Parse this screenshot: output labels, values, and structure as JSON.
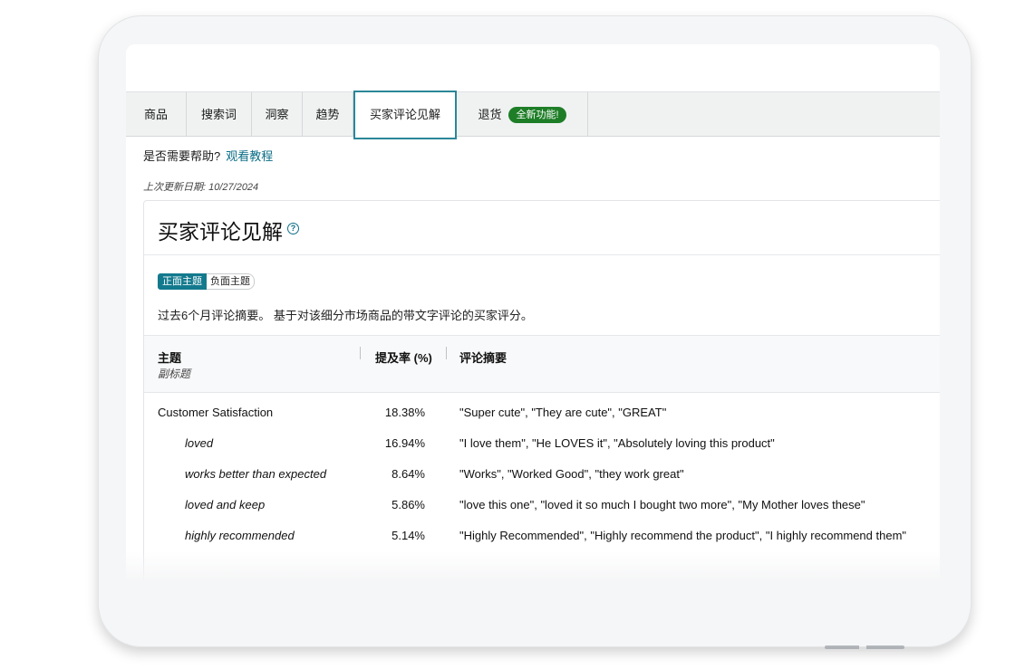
{
  "tabs": [
    {
      "label": "商品"
    },
    {
      "label": "搜索词"
    },
    {
      "label": "洞察"
    },
    {
      "label": "趋势"
    },
    {
      "label": "买家评论见解",
      "active": true
    },
    {
      "label": "退货",
      "badge": "全新功能!"
    }
  ],
  "help": {
    "question": "是否需要帮助?",
    "link": "观看教程"
  },
  "updated": "上次更新日期: 10/27/2024",
  "card": {
    "title": "买家评论见解",
    "info_icon": "question-circle-icon",
    "toggle": {
      "positive": "正面主题",
      "negative": "负面主题",
      "selected": "positive"
    },
    "description": "过去6个月评论摘要。 基于对该细分市场商品的带文字评论的买家评分。"
  },
  "table": {
    "headers": {
      "topic": "主题",
      "subtitle": "副标题",
      "rate": "提及率 (%)",
      "summary": "评论摘要"
    },
    "rows": [
      {
        "topic": "Customer Satisfaction",
        "rate": "18.38%",
        "summary": "\"Super cute\", \"They are cute\", \"GREAT\""
      },
      {
        "topic": "loved",
        "rate": "16.94%",
        "summary": "\"I love them\", \"He LOVES it\", \"Absolutely loving this product\""
      },
      {
        "topic": "works better than expected",
        "rate": "8.64%",
        "summary": "\"Works\", \"Worked Good\", \"they work great\""
      },
      {
        "topic": "loved and keep",
        "rate": "5.86%",
        "summary": "\"love this one\", \"loved it so much I bought two more\", \"My Mother loves these\""
      },
      {
        "topic": "highly recommended",
        "rate": "5.14%",
        "summary": "\"Highly Recommended\", \"Highly recommend the product\", \"I highly recommend them\""
      }
    ]
  },
  "colors": {
    "accent": "#137a8e",
    "link": "#0b6e86",
    "badge": "#1e7e27"
  }
}
